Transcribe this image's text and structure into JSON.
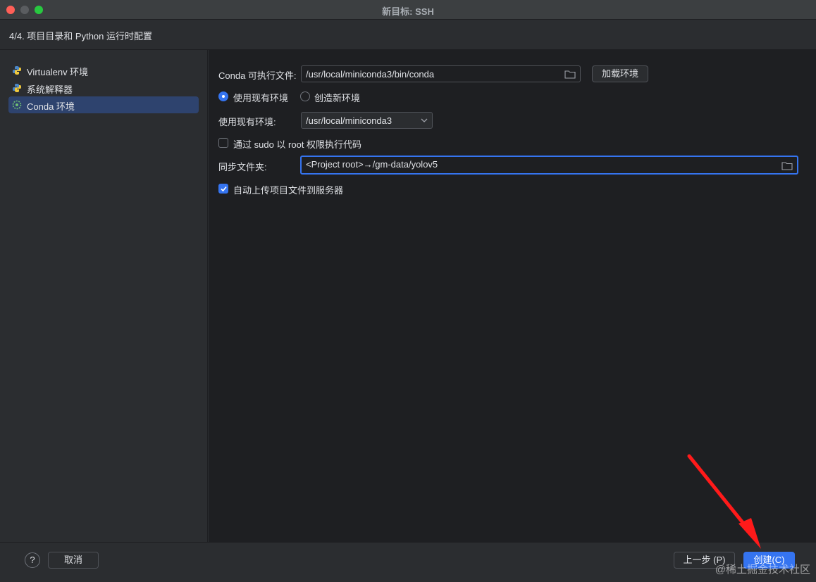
{
  "window": {
    "title": "新目标: SSH",
    "step_title": "4/4. 项目目录和 Python 运行时配置"
  },
  "sidebar": {
    "items": [
      {
        "label": "Virtualenv 环境",
        "icon": "python-icon",
        "selected": false
      },
      {
        "label": "系统解释器",
        "icon": "python-icon",
        "selected": false
      },
      {
        "label": "Conda 环境",
        "icon": "conda-icon",
        "selected": true
      }
    ]
  },
  "form": {
    "conda_exec_label": "Conda 可执行文件:",
    "conda_exec_value": "/usr/local/miniconda3/bin/conda",
    "load_env_button": "加载环境",
    "radio_existing_label": "使用现有环境",
    "radio_new_label": "创造新环境",
    "radio_selected": "existing",
    "existing_env_label": "使用现有环境:",
    "existing_env_value": "/usr/local/miniconda3",
    "sudo_label": "通过 sudo 以 root 权限执行代码",
    "sudo_checked": false,
    "sync_folder_label": "同步文件夹:",
    "sync_folder_value": "<Project root>→/gm-data/yolov5",
    "auto_upload_label": "自动上传项目文件到服务器",
    "auto_upload_checked": true
  },
  "footer": {
    "help_label": "?",
    "cancel_button": "取消",
    "prev_button": "上一步 (P)",
    "create_button": "创建(C)"
  },
  "watermark": "@稀土掘金技术社区",
  "colors": {
    "accent": "#3574f0",
    "annotation_arrow": "#ff1a1a"
  }
}
